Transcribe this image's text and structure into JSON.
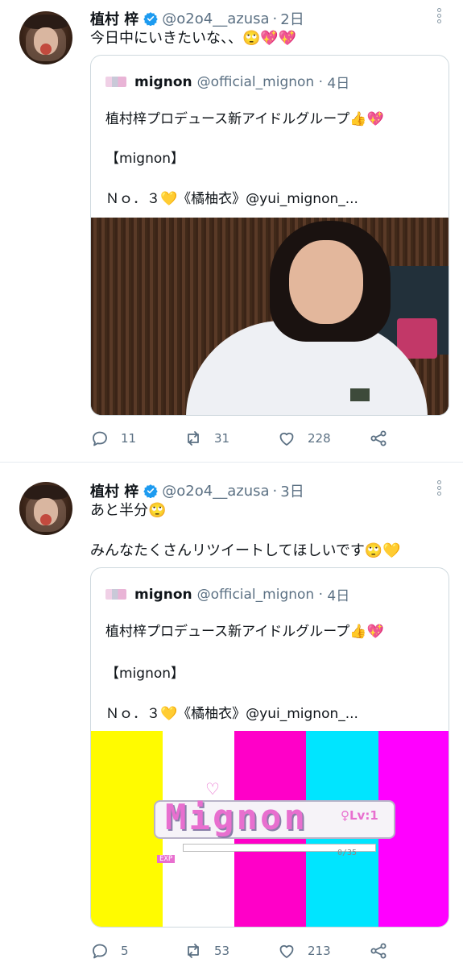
{
  "tweets": [
    {
      "author": {
        "name": "植村 梓",
        "handle": "@o2o4__azusa",
        "verified": true
      },
      "time": "2日",
      "text_lines": [
        "今日中にいきたいな、、🙄💖💖"
      ],
      "quote": {
        "author_name": "mignon",
        "author_handle": "@official_mignon",
        "time": "4日",
        "lines": [
          "植村梓プロデュース新アイドルグループ👍💖",
          "【mignon】",
          "Ｎｏ．３💛《橘柚衣》@yui_mignon_..."
        ]
      },
      "stats": {
        "replies": "11",
        "retweets": "31",
        "likes": "228"
      }
    },
    {
      "author": {
        "name": "植村 梓",
        "handle": "@o2o4__azusa",
        "verified": true
      },
      "time": "3日",
      "text_lines": [
        "あと半分🙄",
        "みんなたくさんリツイートしてほしいです🙄💛"
      ],
      "quote": {
        "author_name": "mignon",
        "author_handle": "@official_mignon",
        "time": "4日",
        "lines": [
          "植村梓プロデュース新アイドルグループ👍💖",
          "【mignon】",
          "Ｎｏ．３💛《橘柚衣》@yui_mignon_..."
        ],
        "image_logo": {
          "word": "Mignon",
          "level": "♀Lv:1",
          "exp": "0/35",
          "tag": "EXP"
        }
      },
      "stats": {
        "replies": "5",
        "retweets": "53",
        "likes": "213"
      }
    }
  ],
  "colors": {
    "text": "#0f1419",
    "secondary": "#5b7083",
    "border": "#cfd9de",
    "verified": "#1d9bf0",
    "stripes": [
      "#fffb00",
      "#ffffff",
      "#ff00c8",
      "#00e5ff",
      "#ff00ff"
    ]
  },
  "icons": [
    "more-vertical-icon",
    "verified-badge-icon",
    "reply-icon",
    "retweet-icon",
    "like-icon",
    "share-icon"
  ]
}
